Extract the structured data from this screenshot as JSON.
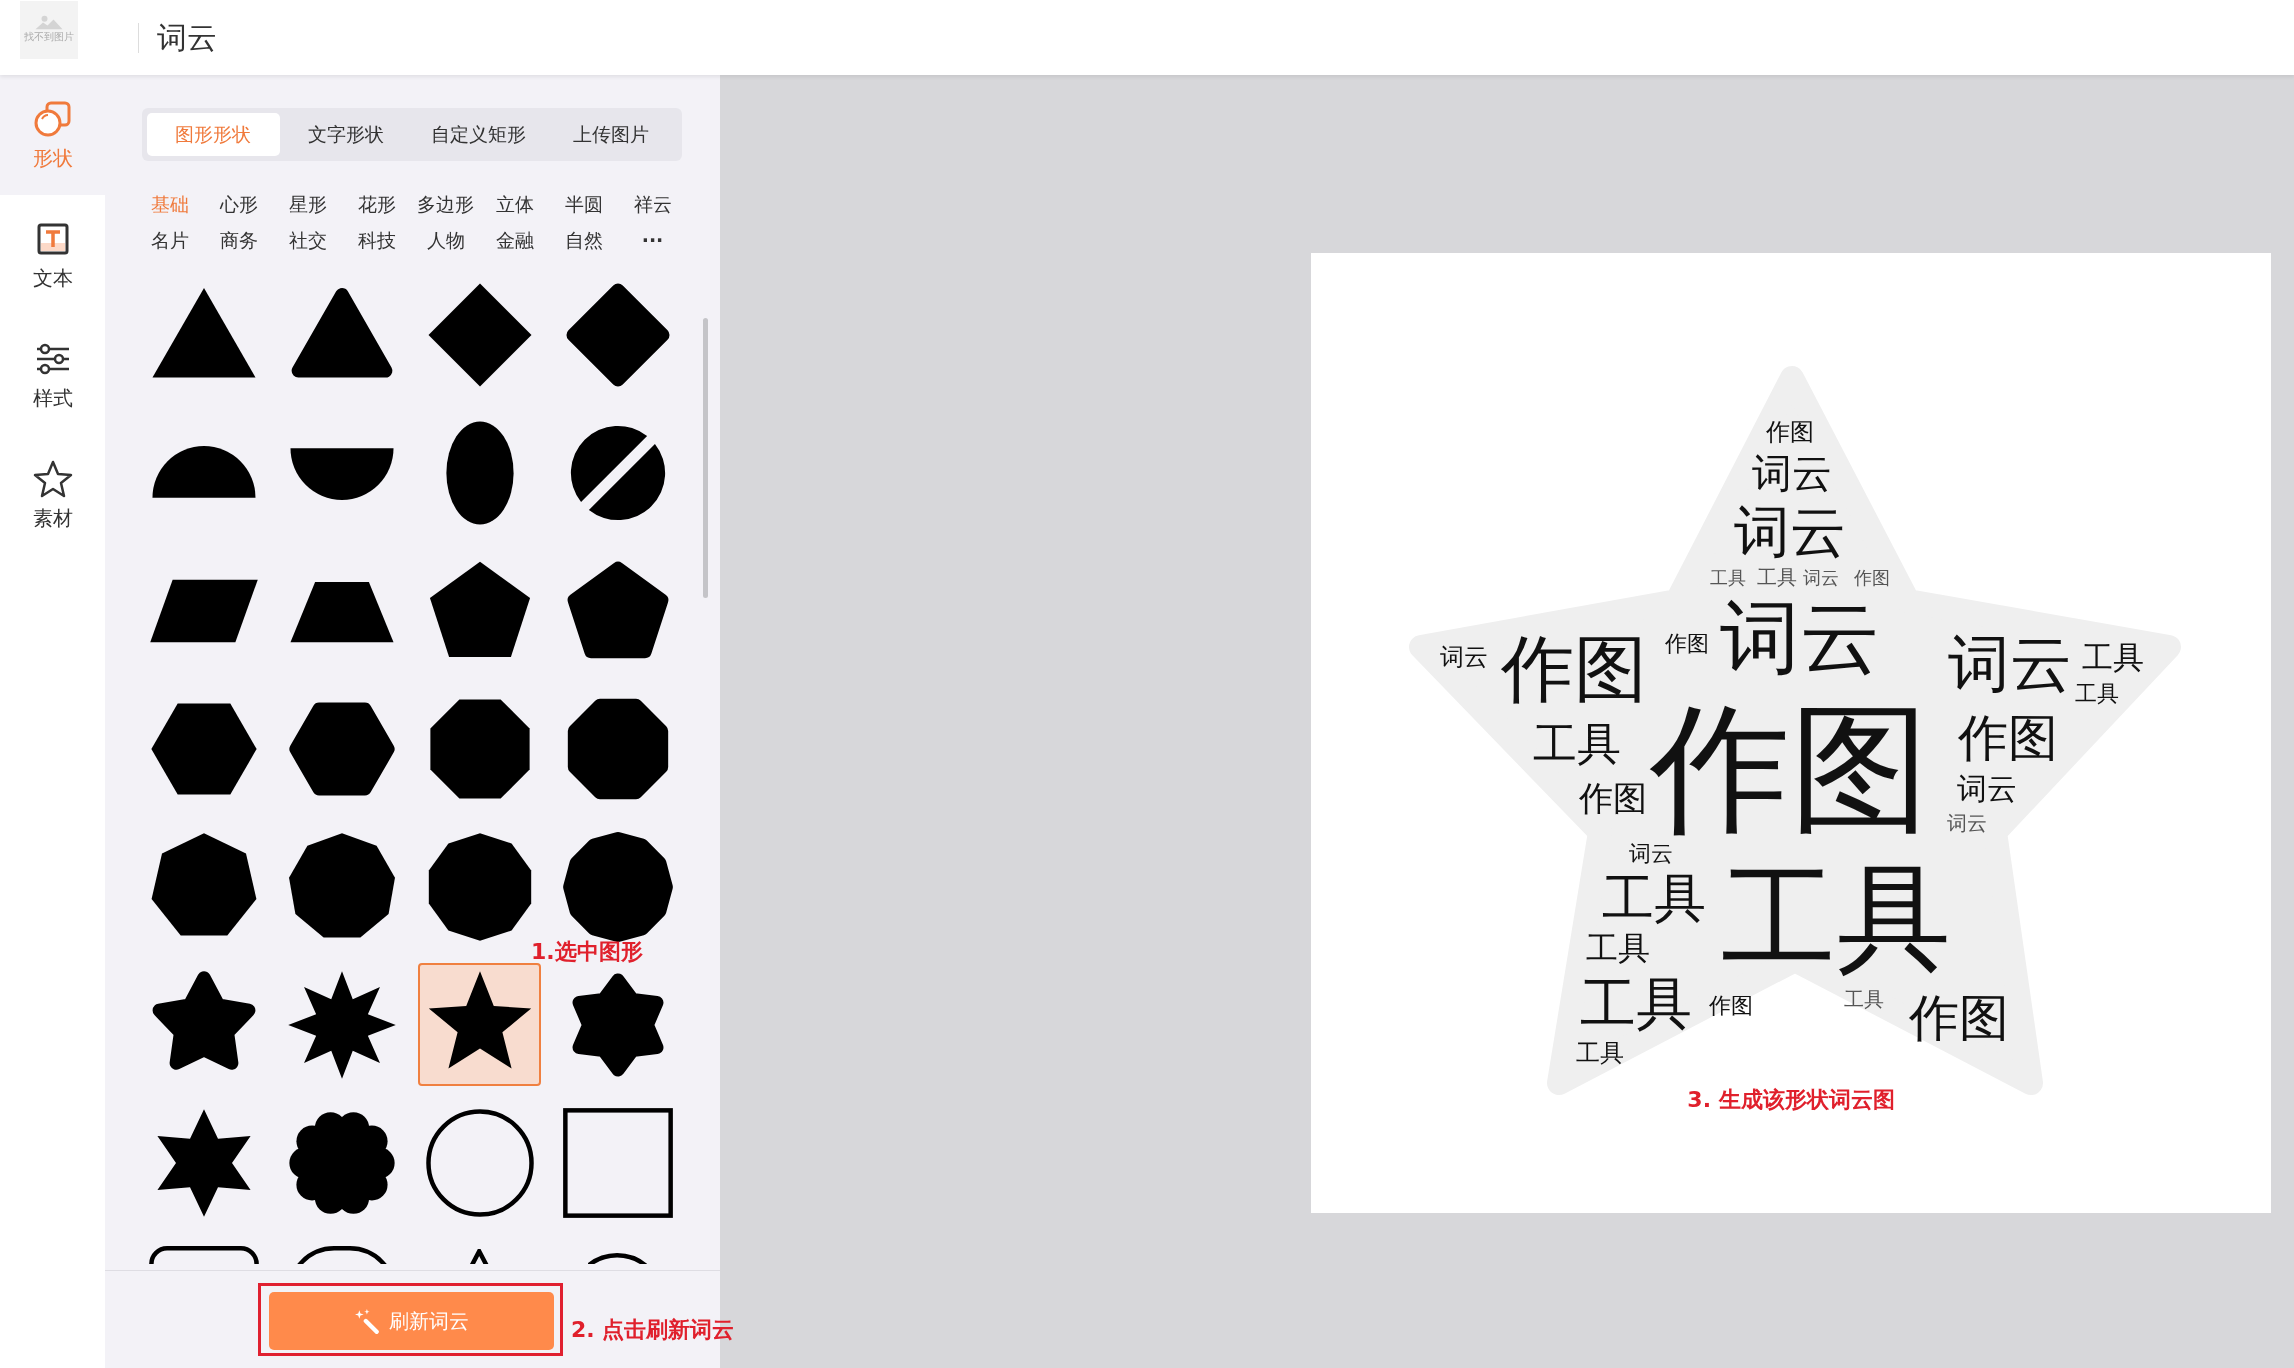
{
  "header": {
    "logo_text": "找不到图片",
    "title": "词云"
  },
  "rail": [
    {
      "label": "形状",
      "selected": true
    },
    {
      "label": "文本",
      "selected": false
    },
    {
      "label": "样式",
      "selected": false
    },
    {
      "label": "素材",
      "selected": false
    }
  ],
  "tabs": [
    {
      "label": "图形形状",
      "selected": true
    },
    {
      "label": "文字形状",
      "selected": false
    },
    {
      "label": "自定义矩形",
      "selected": false
    },
    {
      "label": "上传图片",
      "selected": false
    }
  ],
  "categories": [
    {
      "label": "基础",
      "selected": true
    },
    {
      "label": "心形",
      "selected": false
    },
    {
      "label": "星形",
      "selected": false
    },
    {
      "label": "花形",
      "selected": false
    },
    {
      "label": "多边形",
      "selected": false
    },
    {
      "label": "立体",
      "selected": false
    },
    {
      "label": "半圆",
      "selected": false
    },
    {
      "label": "祥云",
      "selected": false
    },
    {
      "label": "名片",
      "selected": false
    },
    {
      "label": "商务",
      "selected": false
    },
    {
      "label": "社交",
      "selected": false
    },
    {
      "label": "科技",
      "selected": false
    },
    {
      "label": "人物",
      "selected": false
    },
    {
      "label": "金融",
      "selected": false
    },
    {
      "label": "自然",
      "selected": false
    }
  ],
  "more": "···",
  "shapes": [
    {
      "kind": "triangle",
      "selected": false
    },
    {
      "kind": "rounded-triangle",
      "selected": false
    },
    {
      "kind": "diamond",
      "selected": false
    },
    {
      "kind": "rounded-diamond",
      "selected": false
    },
    {
      "kind": "half-disc-top",
      "selected": false
    },
    {
      "kind": "half-disc-bottom",
      "selected": false
    },
    {
      "kind": "ellipse",
      "selected": false
    },
    {
      "kind": "split-circle",
      "selected": false
    },
    {
      "kind": "parallelogram",
      "selected": false
    },
    {
      "kind": "trapezoid",
      "selected": false
    },
    {
      "kind": "pentagon",
      "selected": false
    },
    {
      "kind": "rounded-pentagon",
      "selected": false
    },
    {
      "kind": "hexagon",
      "selected": false
    },
    {
      "kind": "rounded-hexagon",
      "selected": false
    },
    {
      "kind": "octagon",
      "selected": false
    },
    {
      "kind": "rounded-octagon",
      "selected": false
    },
    {
      "kind": "heptagon",
      "selected": false
    },
    {
      "kind": "nonagon",
      "selected": false
    },
    {
      "kind": "decagon",
      "selected": false
    },
    {
      "kind": "dodecagon",
      "selected": false
    },
    {
      "kind": "rounded-star",
      "selected": false
    },
    {
      "kind": "eight-point-star",
      "selected": false
    },
    {
      "kind": "star",
      "selected": true
    },
    {
      "kind": "rounded-six-point-star",
      "selected": false
    },
    {
      "kind": "six-point-star",
      "selected": false
    },
    {
      "kind": "flower",
      "selected": false
    },
    {
      "kind": "circle-outline",
      "selected": false
    },
    {
      "kind": "square-outline",
      "selected": false
    },
    {
      "kind": "rounded-rect-outline",
      "selected": false
    },
    {
      "kind": "stadium-outline",
      "selected": false
    },
    {
      "kind": "triangle-outline",
      "selected": false
    },
    {
      "kind": "arch-outline",
      "selected": false
    }
  ],
  "refresh_button": "刷新词云",
  "annotations": [
    "1.选中图形",
    "2. 点击刷新词云",
    "3. 生成该形状词云图"
  ],
  "word_cloud": {
    "words": [
      "作图",
      "词云",
      "词云",
      "工具",
      "工具",
      "词云",
      "作图",
      "词云",
      "作图",
      "作图",
      "词云",
      "词云",
      "工具",
      "工具",
      "工具",
      "作图",
      "作图",
      "作图",
      "词云",
      "词云",
      "词云",
      "工具",
      "工具",
      "工具",
      "工具",
      "作图",
      "工具",
      "作图",
      "工具"
    ]
  }
}
